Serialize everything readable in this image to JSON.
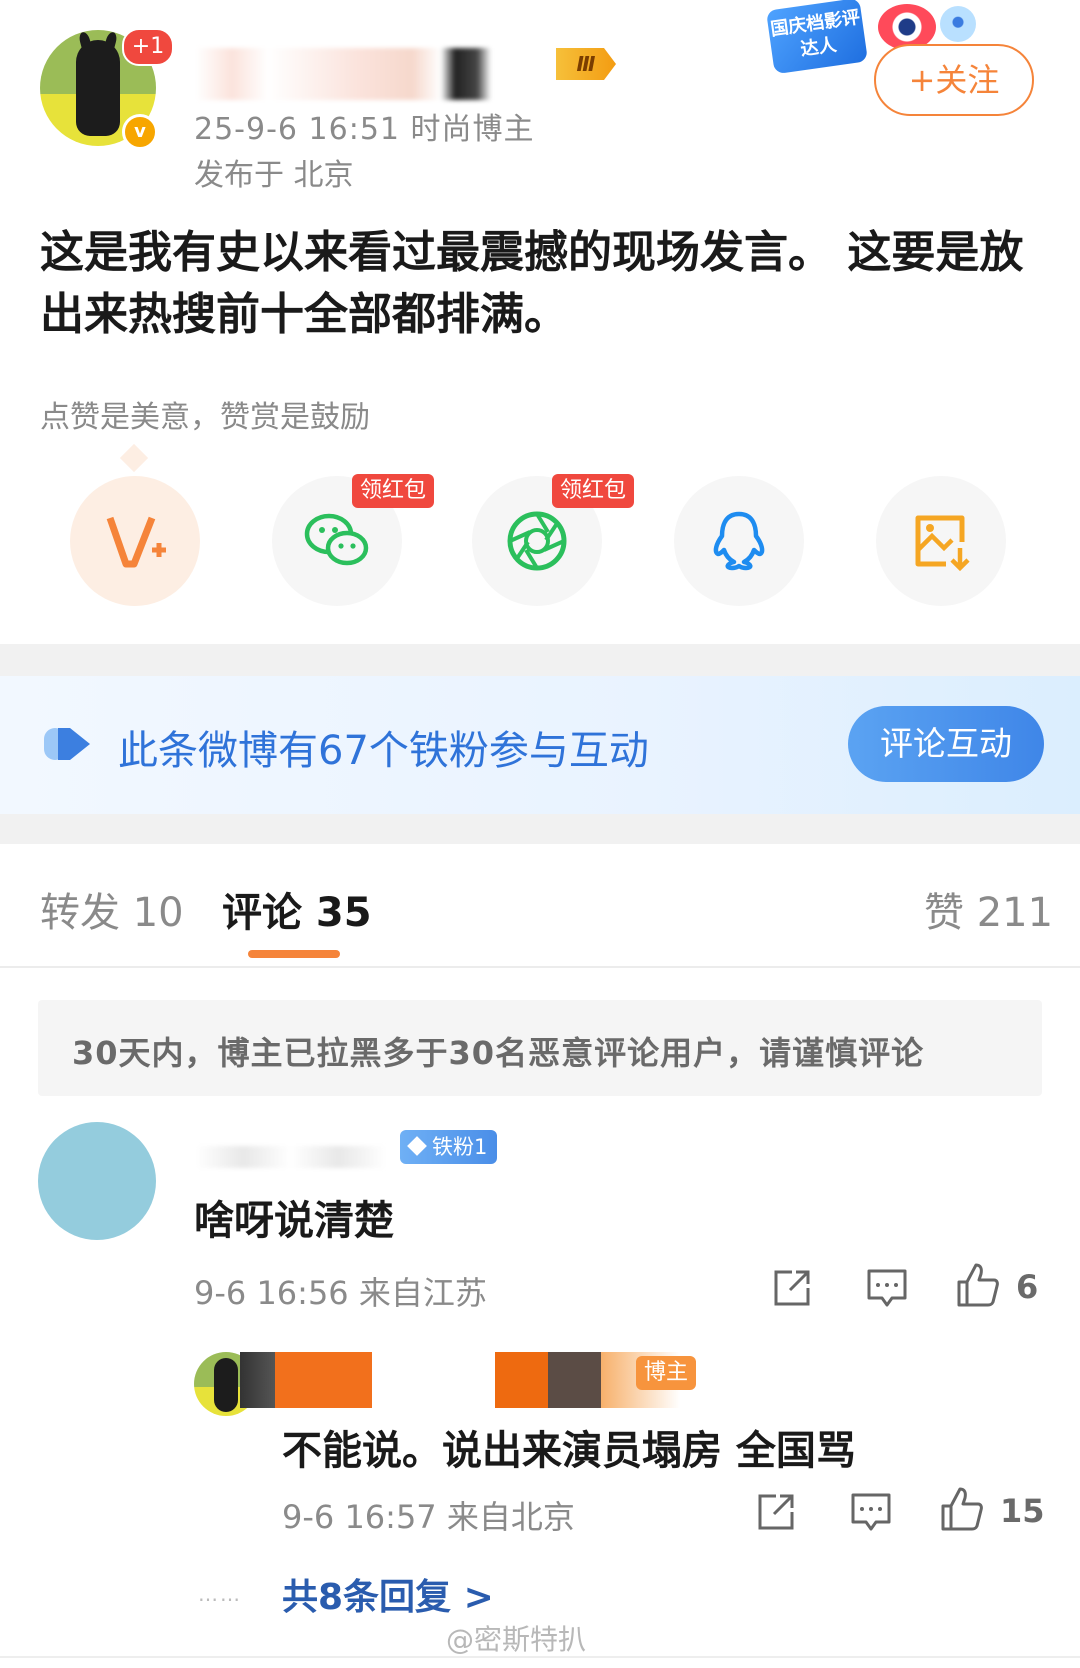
{
  "post": {
    "author_badge_count": "+1",
    "level_badge": "Ⅲ",
    "timestamp_and_tag": "25-9-6 16:51  时尚博主",
    "location": "发布于 北京",
    "text": "这是我有史以来看过最震撼的现场发言。 这要是放出来热搜前十全部都排满。",
    "follow_label": "+关注",
    "event_badge": "国庆档影评达人",
    "reward_caption": "点赞是美意，赞赏是鼓励"
  },
  "share": {
    "red_tag_label": "领红包",
    "items": [
      {
        "name": "reward",
        "icon": "v-plus-icon",
        "color": "#f5843a",
        "tag": false
      },
      {
        "name": "wechat",
        "icon": "wechat-icon",
        "color": "#2bbf5c",
        "tag": true
      },
      {
        "name": "moments",
        "icon": "moments-icon",
        "color": "#2bbf5c",
        "tag": true
      },
      {
        "name": "qq",
        "icon": "qq-icon",
        "color": "#1e8cf0",
        "tag": false
      },
      {
        "name": "save-image",
        "icon": "save-image-icon",
        "color": "#f5a623",
        "tag": false
      }
    ]
  },
  "fans_banner": {
    "text": "此条微博有67个铁粉参与互动",
    "button_label": "评论互动"
  },
  "tabs": {
    "repost": "转发 10",
    "comments": "评论 35",
    "likes": "赞 211"
  },
  "warning": "30天内，博主已拉黑多于30名恶意评论用户，请谨慎评论",
  "comment": {
    "fan_badge": "铁粉1",
    "text": "啥呀说清楚",
    "meta": "9-6 16:56  来自江苏",
    "likes": "6"
  },
  "reply": {
    "tag": "博主",
    "text": "不能说。说出来演员塌房 全国骂",
    "meta": "9-6 16:57  来自北京",
    "likes": "15",
    "dots": "……",
    "more_label": "共8条回复 >"
  },
  "watermark": "@密斯特扒",
  "colors": {
    "accent": "#f5843a",
    "link_blue": "#2a5cae",
    "banner_blue": "#2f73d9"
  }
}
